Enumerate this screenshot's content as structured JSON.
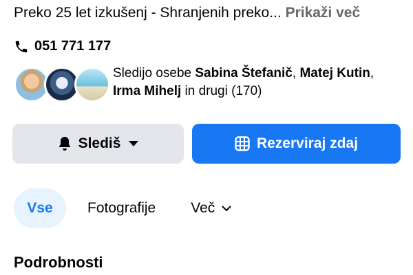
{
  "intro": {
    "text": "Preko 25 let izkušenj - Shranjenih preko...",
    "more_label": "Prikaži več"
  },
  "contact": {
    "phone": "051 771 177",
    "icon": "phone-icon"
  },
  "followers": {
    "prefix": "Sledijo osebe ",
    "name_1": "Sabina Štefanič",
    "sep_1": ", ",
    "name_2": "Matej Kutin",
    "sep_2": ",",
    "name_3": "Irma Mihelj",
    "suffix": " in drugi (170)"
  },
  "actions": {
    "follow_label": "Slediš",
    "follow_icon": "bell-icon",
    "book_label": "Rezerviraj zdaj",
    "book_icon": "calendar-grid-icon"
  },
  "tabs": [
    {
      "label": "Vse",
      "active": true
    },
    {
      "label": "Fotografije",
      "active": false
    },
    {
      "label": "Več",
      "active": false
    }
  ],
  "section": {
    "title": "Podrobnosti"
  },
  "colors": {
    "accent": "#1877f2",
    "accent_light": "#e7f3ff",
    "button_gray": "#e4e6eb",
    "muted_text": "#65676b"
  }
}
